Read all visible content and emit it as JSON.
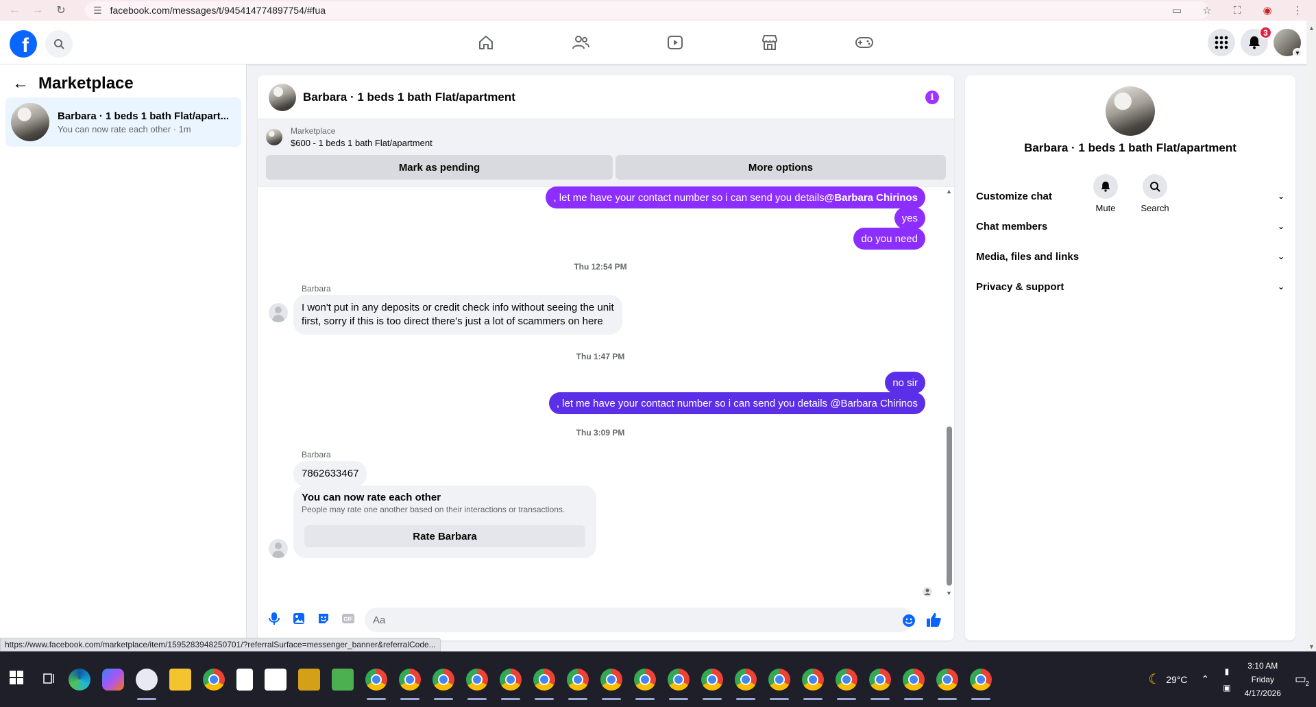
{
  "browser": {
    "url": "facebook.com/messages/t/945414774897754/#fua"
  },
  "header": {
    "logo_letter": "f",
    "notification_count": "3"
  },
  "sidebar": {
    "title": "Marketplace",
    "conversation": {
      "name": "Barbara · 1 beds 1 bath Flat/apart...",
      "subtitle": "You can now rate each other · 1m"
    }
  },
  "chat": {
    "title": "Barbara · 1 beds 1 bath Flat/apartment",
    "marketplace_label": "Marketplace",
    "listing": "$600 - 1 beds 1 bath Flat/apartment",
    "pending_button": "Mark as pending",
    "more_button": "More options",
    "messages": {
      "out1_text": ", let me have your contact number so i can send you details ",
      "out1_mention": "@Barbara Chirinos",
      "out2": "yes",
      "out3": "do you need",
      "ts1": "Thu 12:54 PM",
      "sender1": "Barbara",
      "in1": "I won't put in any deposits or credit check info without seeing the unit first, sorry if this is too direct there's just a lot of scammers on here",
      "ts2": "Thu 1:47 PM",
      "out4": "no  sir",
      "out5": ", let me have your contact number so i can send you details @Barbara Chirinos",
      "ts3": "Thu 3:09 PM",
      "sender2": "Barbara",
      "in2": "7862633467",
      "rate_title": "You can now rate each other",
      "rate_desc": "People may rate one another based on their interactions or transactions.",
      "rate_button": "Rate Barbara"
    },
    "composer_placeholder": "Aa"
  },
  "details": {
    "name": "Barbara · 1 beds 1 bath Flat/apartment",
    "mute_label": "Mute",
    "search_label": "Search",
    "sections": [
      "Customize chat",
      "Chat members",
      "Media, files and links",
      "Privacy & support"
    ]
  },
  "status_url": "https://www.facebook.com/marketplace/item/1595283948250701/?referralSurface=messenger_banner&referralCode...",
  "taskbar": {
    "temperature": "29°C",
    "time": "3:10 AM",
    "day": "Friday",
    "date": "4/17/2026",
    "notification_count": "2"
  },
  "colors": {
    "accent_purple": "#8c2eff",
    "facebook_blue": "#0866ff"
  }
}
